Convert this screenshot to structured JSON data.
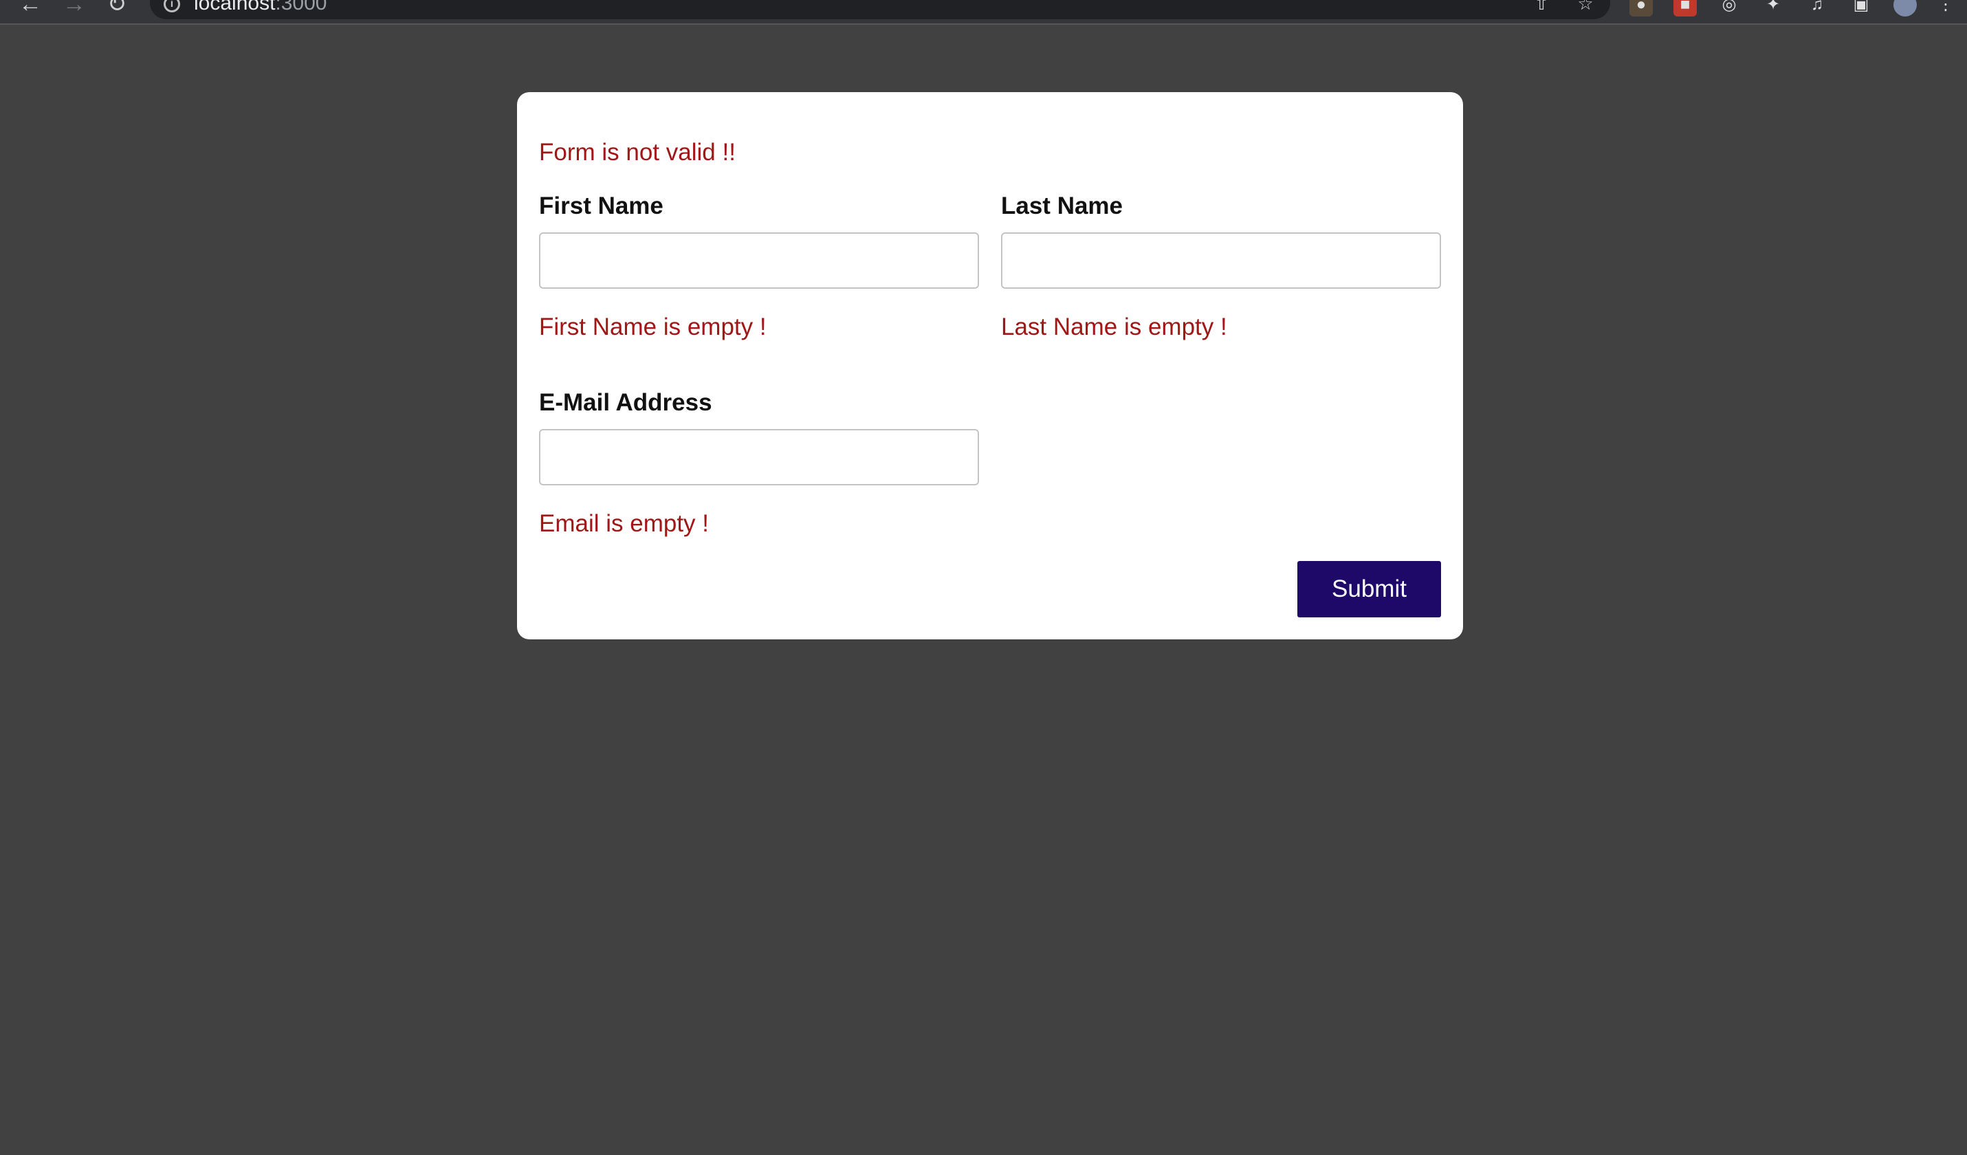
{
  "browser": {
    "url_host": "localhost",
    "url_port": ":3000",
    "back_icon": "arrow-left-icon",
    "forward_icon": "arrow-right-icon",
    "reload_icon": "reload-icon"
  },
  "form": {
    "form_error": "Form is not valid !!",
    "first_name": {
      "label": "First Name",
      "value": "",
      "error": "First Name is empty !"
    },
    "last_name": {
      "label": "Last Name",
      "value": "",
      "error": "Last Name is empty !"
    },
    "email": {
      "label": "E-Mail Address",
      "value": "",
      "error": "Email is empty !"
    },
    "submit_label": "Submit"
  },
  "colors": {
    "page_background": "#414141",
    "error_text": "#a11616",
    "submit_button": "#1e0969"
  }
}
